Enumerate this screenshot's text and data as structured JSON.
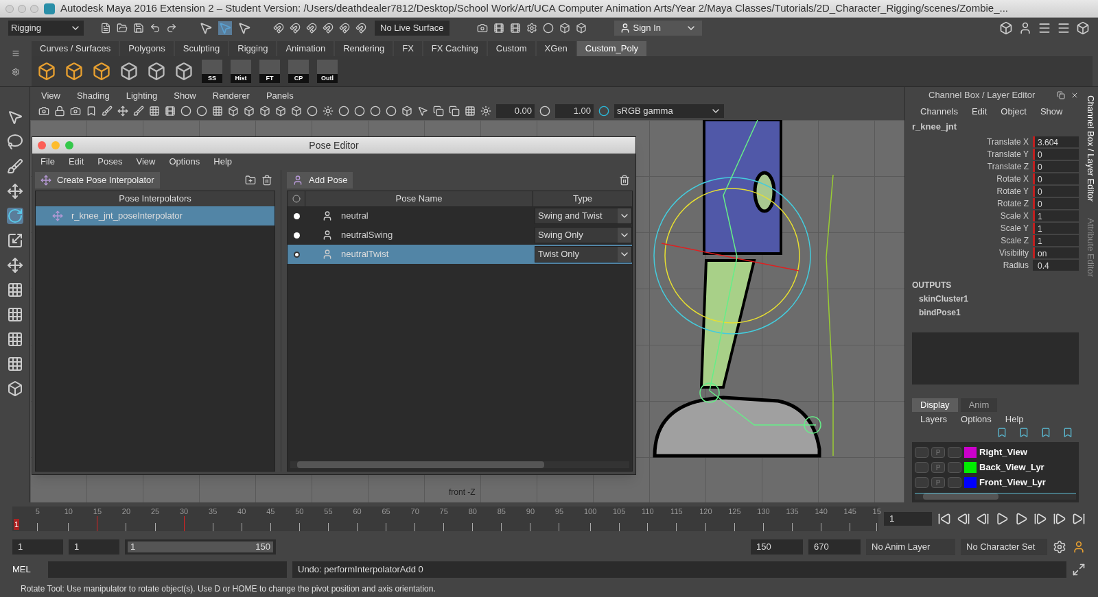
{
  "window": {
    "title": "Autodesk Maya 2016 Extension 2 – Student Version: /Users/deathdealer7812/Desktop/School Work/Art/UCA Computer Animation Arts/Year 2/Maya Classes/Tutorials/2D_Character_Rigging/scenes/Zombie_..."
  },
  "status_line": {
    "menu_set": "Rigging",
    "live_surface": "No Live Surface",
    "sign_in": "Sign In"
  },
  "shelf": {
    "tabs": [
      {
        "label": "Curves / Surfaces",
        "selected": false
      },
      {
        "label": "Polygons",
        "selected": false
      },
      {
        "label": "Sculpting",
        "selected": false
      },
      {
        "label": "Rigging",
        "selected": false
      },
      {
        "label": "Animation",
        "selected": false
      },
      {
        "label": "Rendering",
        "selected": false
      },
      {
        "label": "FX",
        "selected": false
      },
      {
        "label": "FX Caching",
        "selected": false
      },
      {
        "label": "Custom",
        "selected": false
      },
      {
        "label": "XGen",
        "selected": false
      },
      {
        "label": "Custom_Poly",
        "selected": true
      }
    ],
    "labelled_buttons": [
      "SS",
      "Hist",
      "FT",
      "CP",
      "Outl"
    ]
  },
  "viewport": {
    "menus": [
      "View",
      "Shading",
      "Lighting",
      "Show",
      "Renderer",
      "Panels"
    ],
    "exposure": "0.00",
    "gamma": "1.00",
    "color_space": "sRGB gamma",
    "camera_label": "front -Z"
  },
  "pose_editor": {
    "title": "Pose Editor",
    "menus": [
      "File",
      "Edit",
      "Poses",
      "View",
      "Options",
      "Help"
    ],
    "create_button": "Create Pose Interpolator",
    "interpolators_header": "Pose Interpolators",
    "interpolators": [
      {
        "name": "r_knee_jnt_poseInterpolator",
        "selected": true
      }
    ],
    "add_button": "Add Pose",
    "columns": [
      "Pose Name",
      "Type"
    ],
    "poses": [
      {
        "name": "neutral",
        "type": "Swing and Twist",
        "selected": false
      },
      {
        "name": "neutralSwing",
        "type": "Swing Only",
        "selected": false
      },
      {
        "name": "neutralTwist",
        "type": "Twist Only",
        "selected": true
      }
    ]
  },
  "channel_box": {
    "title": "Channel Box / Layer Editor",
    "menus": [
      "Channels",
      "Edit",
      "Object",
      "Show"
    ],
    "node": "r_knee_jnt",
    "channels": [
      {
        "name": "Translate X",
        "value": "3.604",
        "keyed": true
      },
      {
        "name": "Translate Y",
        "value": "0",
        "keyed": true
      },
      {
        "name": "Translate Z",
        "value": "0",
        "keyed": true
      },
      {
        "name": "Rotate X",
        "value": "0",
        "keyed": true
      },
      {
        "name": "Rotate Y",
        "value": "0",
        "keyed": true
      },
      {
        "name": "Rotate Z",
        "value": "0",
        "keyed": true
      },
      {
        "name": "Scale X",
        "value": "1",
        "keyed": true
      },
      {
        "name": "Scale Y",
        "value": "1",
        "keyed": true
      },
      {
        "name": "Scale Z",
        "value": "1",
        "keyed": true
      },
      {
        "name": "Visibility",
        "value": "on",
        "keyed": true
      },
      {
        "name": "Radius",
        "value": "0.4",
        "keyed": false
      }
    ],
    "outputs_header": "OUTPUTS",
    "outputs": [
      "skinCluster1",
      "bindPose1"
    ],
    "side_tabs": [
      {
        "label": "Channel Box / Layer Editor",
        "selected": true
      },
      {
        "label": "Attribute Editor",
        "selected": false
      }
    ]
  },
  "layer_editor": {
    "tabs": [
      {
        "label": "Display",
        "selected": true
      },
      {
        "label": "Anim",
        "selected": false
      }
    ],
    "menus": [
      "Layers",
      "Options",
      "Help"
    ],
    "layers": [
      {
        "name": "Right_View",
        "color": "#cc00cc",
        "p": "P"
      },
      {
        "name": "Back_View_Lyr",
        "color": "#00ee00",
        "p": "P"
      },
      {
        "name": "Front_View_Lyr",
        "color": "#0000ff",
        "p": "P"
      }
    ]
  },
  "time_slider": {
    "ticks": [
      {
        "label": "5",
        "key": false
      },
      {
        "label": "10",
        "key": false
      },
      {
        "label": "15",
        "key": true
      },
      {
        "label": "20",
        "key": false
      },
      {
        "label": "25",
        "key": false
      },
      {
        "label": "30",
        "key": true
      },
      {
        "label": "35",
        "key": false
      },
      {
        "label": "40",
        "key": false
      },
      {
        "label": "45",
        "key": false
      },
      {
        "label": "50",
        "key": false
      },
      {
        "label": "55",
        "key": false
      },
      {
        "label": "60",
        "key": false
      },
      {
        "label": "65",
        "key": false
      },
      {
        "label": "70",
        "key": false
      },
      {
        "label": "75",
        "key": false
      },
      {
        "label": "80",
        "key": false
      },
      {
        "label": "85",
        "key": false
      },
      {
        "label": "90",
        "key": false
      },
      {
        "label": "95",
        "key": false
      },
      {
        "label": "100",
        "key": false
      },
      {
        "label": "105",
        "key": false
      },
      {
        "label": "110",
        "key": false
      },
      {
        "label": "115",
        "key": false
      },
      {
        "label": "120",
        "key": false
      },
      {
        "label": "125",
        "key": false
      },
      {
        "label": "130",
        "key": false
      },
      {
        "label": "135",
        "key": false
      },
      {
        "label": "140",
        "key": false
      },
      {
        "label": "145",
        "key": false
      },
      {
        "label": "15",
        "key": false
      }
    ],
    "current_marker": "1",
    "current_frame": "1"
  },
  "range_slider": {
    "level": 1,
    "start": "1",
    "playback_start": "1",
    "range_start": "1",
    "range_end": "150",
    "playback_end": "150",
    "end": "670",
    "anim_layer": "No Anim Layer",
    "character_set": "No Character Set"
  },
  "command_line": {
    "language": "MEL",
    "result": "Undo: performInterpolatorAdd 0"
  },
  "help_line": "Rotate Tool: Use manipulator to rotate object(s). Use D or HOME to change the pivot position and axis orientation."
}
